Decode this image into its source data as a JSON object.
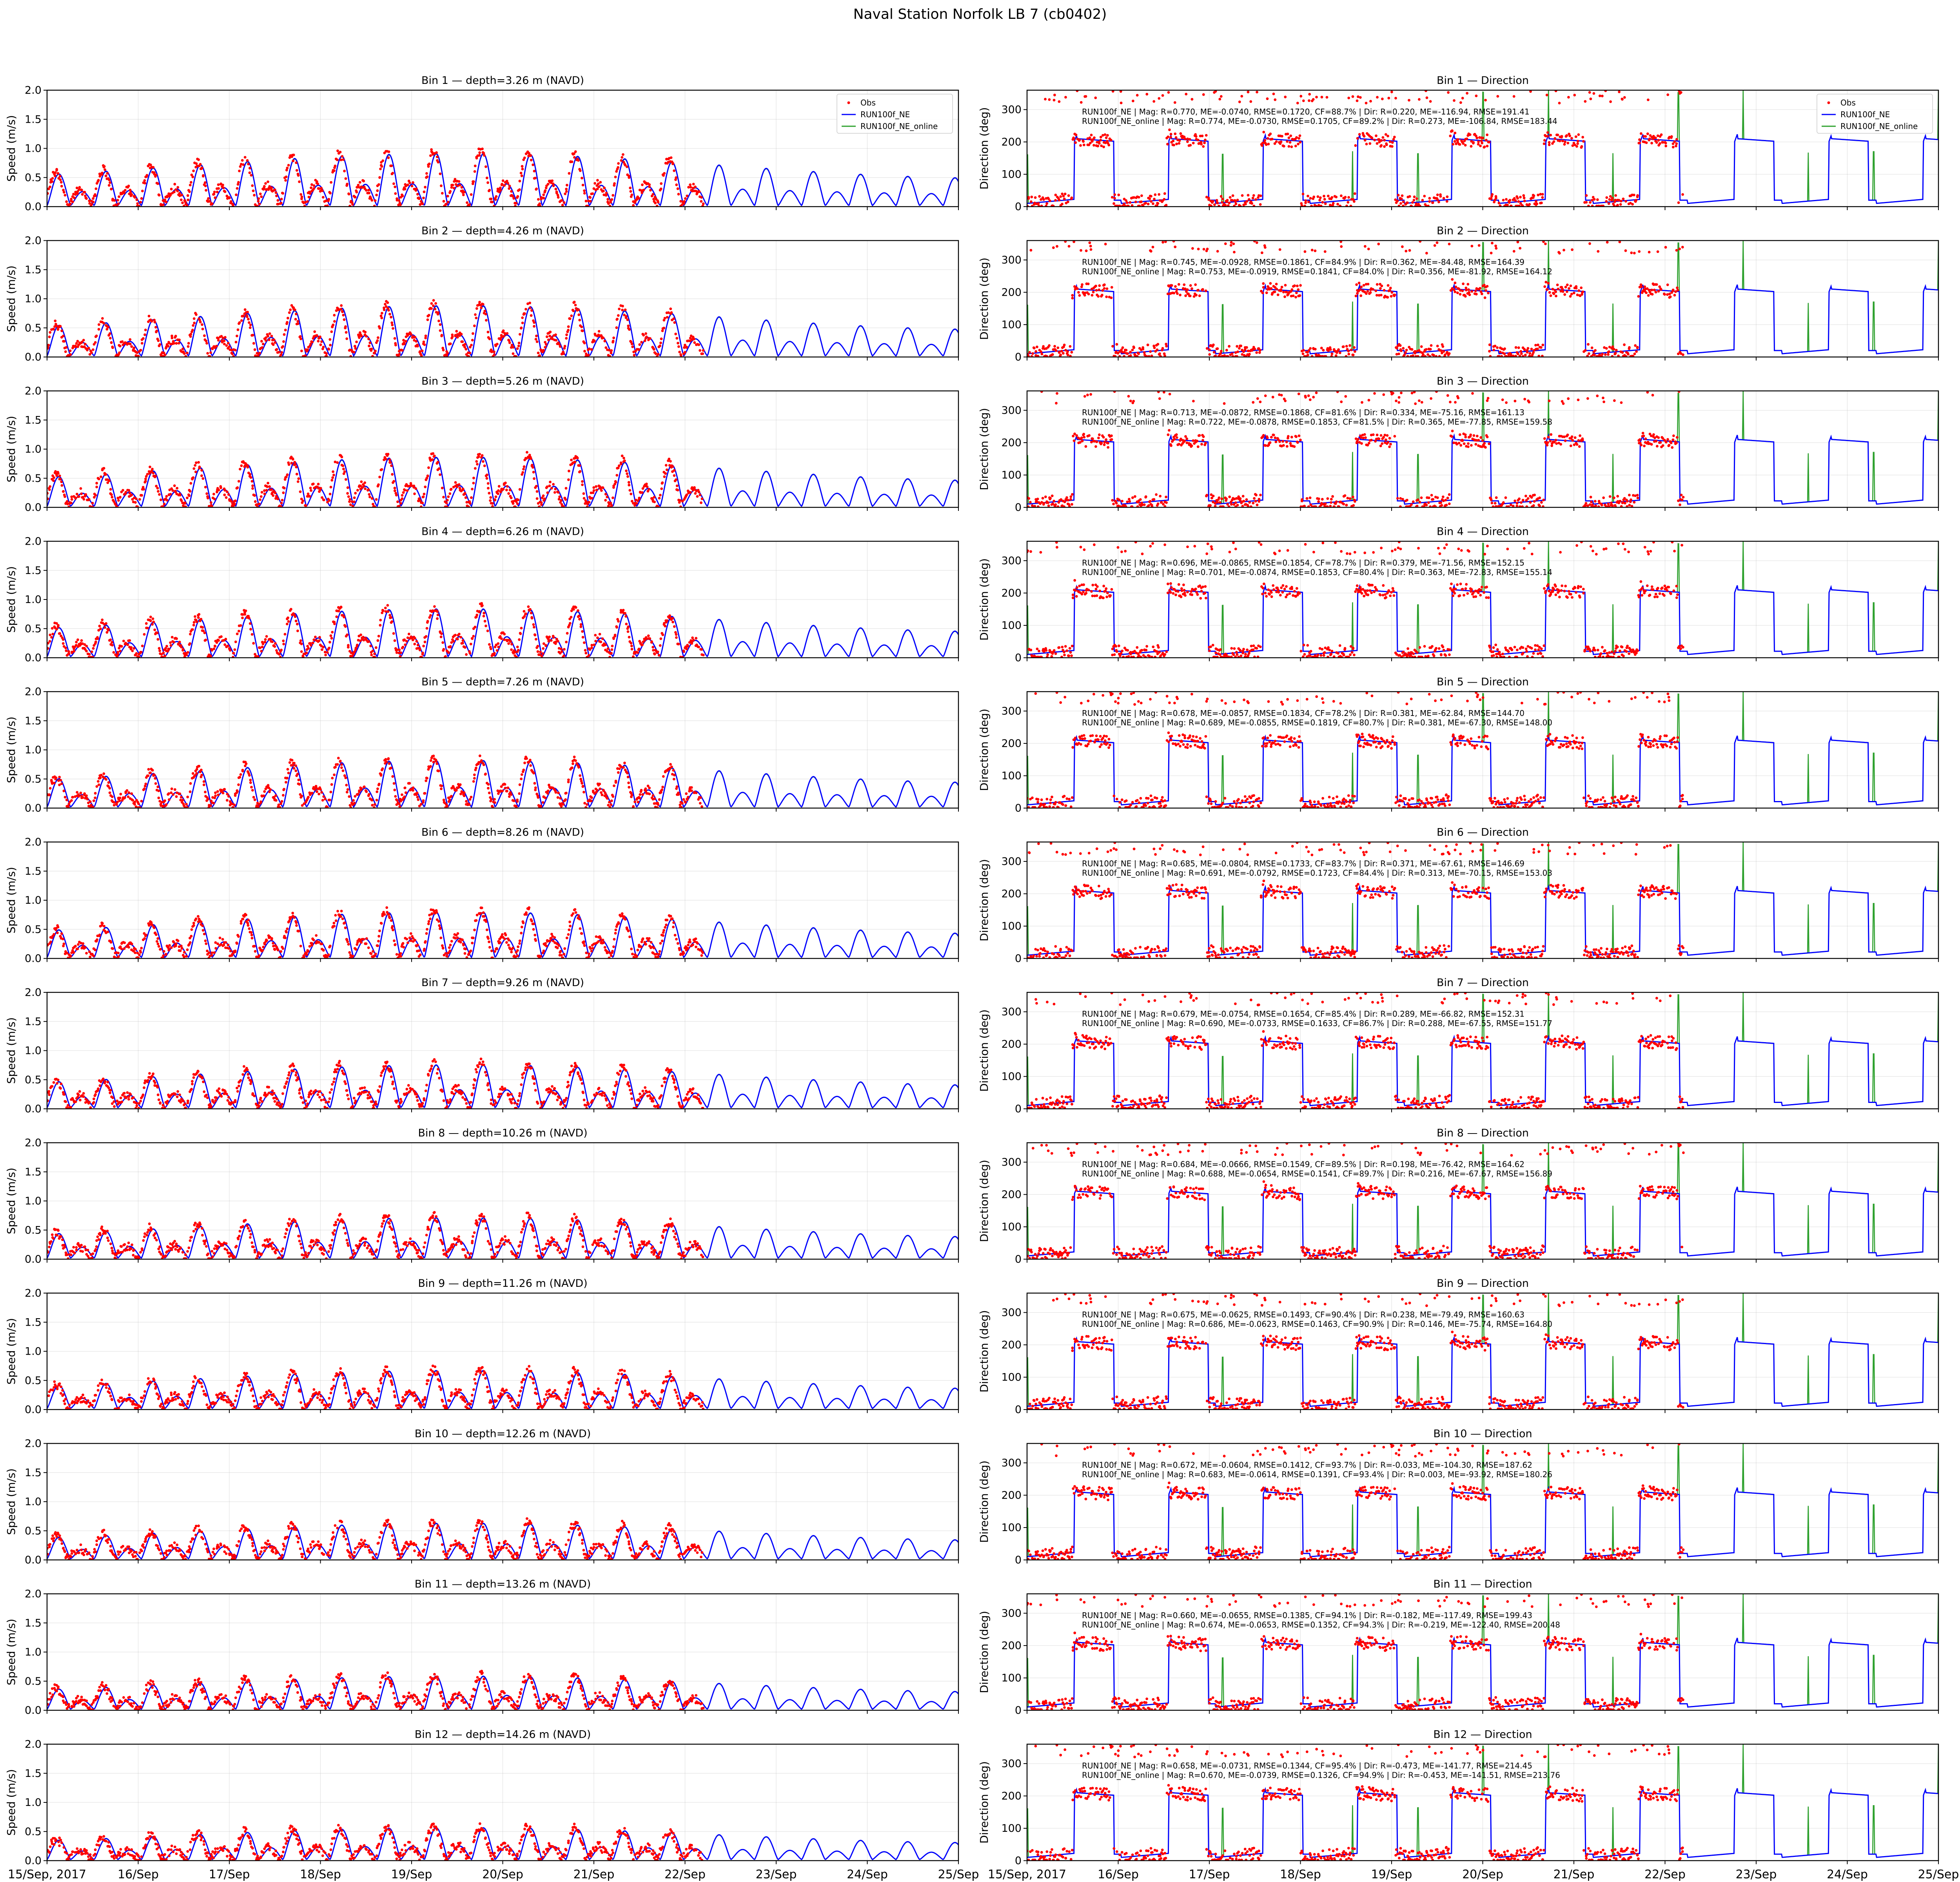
{
  "figure": {
    "suptitle": "Naval Station Norfolk LB 7 (cb0402)"
  },
  "colors": {
    "obs": "#ff0000",
    "model": "#0000ff",
    "model_online": "#2ca02c"
  },
  "legend": [
    "Obs",
    "RUN100f_NE",
    "RUN100f_NE_online"
  ],
  "x_ticks": [
    "15/Sep, 2017",
    "16/Sep",
    "17/Sep",
    "18/Sep",
    "19/Sep",
    "20/Sep",
    "21/Sep",
    "22/Sep",
    "23/Sep",
    "24/Sep",
    "25/Sep"
  ],
  "speed_axis": {
    "ylabel": "Speed (m/s)",
    "ticks": [
      "0.0",
      "0.5",
      "1.0",
      "1.5",
      "2.0"
    ]
  },
  "direction_axis": {
    "ylabel": "Direction (deg)",
    "ticks": [
      "0",
      "100",
      "200",
      "300"
    ]
  },
  "speed_titles": [
    "Bin 1 — depth=3.26 m (NAVD)",
    "Bin 2 — depth=4.26 m (NAVD)",
    "Bin 3 — depth=5.26 m (NAVD)",
    "Bin 4 — depth=6.26 m (NAVD)",
    "Bin 5 — depth=7.26 m (NAVD)",
    "Bin 6 — depth=8.26 m (NAVD)",
    "Bin 7 — depth=9.26 m (NAVD)",
    "Bin 8 — depth=10.26 m (NAVD)",
    "Bin 9 — depth=11.26 m (NAVD)",
    "Bin 10 — depth=12.26 m (NAVD)",
    "Bin 11 — depth=13.26 m (NAVD)",
    "Bin 12 — depth=14.26 m (NAVD)"
  ],
  "direction_titles": [
    "Bin 1 — Direction",
    "Bin 2 — Direction",
    "Bin 3 — Direction",
    "Bin 4 — Direction",
    "Bin 5 — Direction",
    "Bin 6 — Direction",
    "Bin 7 — Direction",
    "Bin 8 — Direction",
    "Bin 9 — Direction",
    "Bin 10 — Direction",
    "Bin 11 — Direction",
    "Bin 12 — Direction"
  ],
  "stats": [
    [
      "RUN100f_NE | Mag: R=0.770, ME=-0.0740, RMSE=0.1720, CF=88.7% | Dir: R=0.220, ME=-116.94, RMSE=191.41",
      "RUN100f_NE_online | Mag: R=0.774, ME=-0.0730, RMSE=0.1705, CF=89.2% | Dir: R=0.273, ME=-106.84, RMSE=183.44"
    ],
    [
      "RUN100f_NE | Mag: R=0.745, ME=-0.0928, RMSE=0.1861, CF=84.9% | Dir: R=0.362, ME=-84.48, RMSE=164.39",
      "RUN100f_NE_online | Mag: R=0.753, ME=-0.0919, RMSE=0.1841, CF=84.0% | Dir: R=0.356, ME=-81.92, RMSE=164.12"
    ],
    [
      "RUN100f_NE | Mag: R=0.713, ME=-0.0872, RMSE=0.1868, CF=81.6% | Dir: R=0.334, ME=-75.16, RMSE=161.13",
      "RUN100f_NE_online | Mag: R=0.722, ME=-0.0878, RMSE=0.1853, CF=81.5% | Dir: R=0.365, ME=-77.85, RMSE=159.58"
    ],
    [
      "RUN100f_NE | Mag: R=0.696, ME=-0.0865, RMSE=0.1854, CF=78.7% | Dir: R=0.379, ME=-71.56, RMSE=152.15",
      "RUN100f_NE_online | Mag: R=0.701, ME=-0.0874, RMSE=0.1853, CF=80.4% | Dir: R=0.363, ME=-72.83, RMSE=155.14"
    ],
    [
      "RUN100f_NE | Mag: R=0.678, ME=-0.0857, RMSE=0.1834, CF=78.2% | Dir: R=0.381, ME=-62.84, RMSE=144.70",
      "RUN100f_NE_online | Mag: R=0.689, ME=-0.0855, RMSE=0.1819, CF=80.7% | Dir: R=0.381, ME=-67.30, RMSE=148.00"
    ],
    [
      "RUN100f_NE | Mag: R=0.685, ME=-0.0804, RMSE=0.1733, CF=83.7% | Dir: R=0.371, ME=-67.61, RMSE=146.69",
      "RUN100f_NE_online | Mag: R=0.691, ME=-0.0792, RMSE=0.1723, CF=84.4% | Dir: R=0.313, ME=-70.15, RMSE=153.03"
    ],
    [
      "RUN100f_NE | Mag: R=0.679, ME=-0.0754, RMSE=0.1654, CF=85.4% | Dir: R=0.289, ME=-66.82, RMSE=152.31",
      "RUN100f_NE_online | Mag: R=0.690, ME=-0.0733, RMSE=0.1633, CF=86.7% | Dir: R=0.288, ME=-67.55, RMSE=151.77"
    ],
    [
      "RUN100f_NE | Mag: R=0.684, ME=-0.0666, RMSE=0.1549, CF=89.5% | Dir: R=0.198, ME=-76.42, RMSE=164.62",
      "RUN100f_NE_online | Mag: R=0.688, ME=-0.0654, RMSE=0.1541, CF=89.7% | Dir: R=0.216, ME=-67.67, RMSE=156.89"
    ],
    [
      "RUN100f_NE | Mag: R=0.675, ME=-0.0625, RMSE=0.1493, CF=90.4% | Dir: R=0.238, ME=-79.49, RMSE=160.63",
      "RUN100f_NE_online | Mag: R=0.686, ME=-0.0623, RMSE=0.1463, CF=90.9% | Dir: R=0.146, ME=-75.74, RMSE=164.80"
    ],
    [
      "RUN100f_NE | Mag: R=0.672, ME=-0.0604, RMSE=0.1412, CF=93.7% | Dir: R=-0.033, ME=-104.30, RMSE=187.62",
      "RUN100f_NE_online | Mag: R=0.683, ME=-0.0614, RMSE=0.1391, CF=93.4% | Dir: R=0.003, ME=-93.92, RMSE=180.26"
    ],
    [
      "RUN100f_NE | Mag: R=0.660, ME=-0.0655, RMSE=0.1385, CF=94.1% | Dir: R=-0.182, ME=-117.49, RMSE=199.43",
      "RUN100f_NE_online | Mag: R=0.674, ME=-0.0653, RMSE=0.1352, CF=94.3% | Dir: R=-0.219, ME=-122.40, RMSE=200.48"
    ],
    [
      "RUN100f_NE | Mag: R=0.658, ME=-0.0731, RMSE=0.1344, CF=95.4% | Dir: R=-0.473, ME=-141.77, RMSE=214.45",
      "RUN100f_NE_online | Mag: R=0.670, ME=-0.0739, RMSE=0.1326, CF=94.9% | Dir: R=-0.453, ME=-141.51, RMSE=213.76"
    ]
  ],
  "chart_data": {
    "type": "line",
    "x_range": [
      "2017-09-15",
      "2017-09-25"
    ],
    "speed_ylim": [
      0,
      2.0
    ],
    "direction_ylim": [
      0,
      360
    ],
    "grid": true,
    "legend_placement": "top-right",
    "series_names": [
      "Obs",
      "RUN100f_NE",
      "RUN100f_NE_online"
    ],
    "bins": [
      {
        "bin": 1,
        "depth_m": 3.26,
        "peak_speed": 0.85,
        "obs_end_day": 7.2
      },
      {
        "bin": 2,
        "depth_m": 4.26,
        "peak_speed": 0.82,
        "obs_end_day": 7.2
      },
      {
        "bin": 3,
        "depth_m": 5.26,
        "peak_speed": 0.8,
        "obs_end_day": 7.2
      },
      {
        "bin": 4,
        "depth_m": 6.26,
        "peak_speed": 0.78,
        "obs_end_day": 7.2
      },
      {
        "bin": 5,
        "depth_m": 7.26,
        "peak_speed": 0.76,
        "obs_end_day": 7.2
      },
      {
        "bin": 6,
        "depth_m": 8.26,
        "peak_speed": 0.74,
        "obs_end_day": 7.2
      },
      {
        "bin": 7,
        "depth_m": 9.26,
        "peak_speed": 0.7,
        "obs_end_day": 7.2
      },
      {
        "bin": 8,
        "depth_m": 10.26,
        "peak_speed": 0.66,
        "obs_end_day": 7.2
      },
      {
        "bin": 9,
        "depth_m": 11.26,
        "peak_speed": 0.62,
        "obs_end_day": 7.2
      },
      {
        "bin": 10,
        "depth_m": 12.26,
        "peak_speed": 0.58,
        "obs_end_day": 7.2
      },
      {
        "bin": 11,
        "depth_m": 13.26,
        "peak_speed": 0.54,
        "obs_end_day": 7.2
      },
      {
        "bin": 12,
        "depth_m": 14.26,
        "peak_speed": 0.52,
        "obs_end_day": 7.2
      }
    ]
  }
}
